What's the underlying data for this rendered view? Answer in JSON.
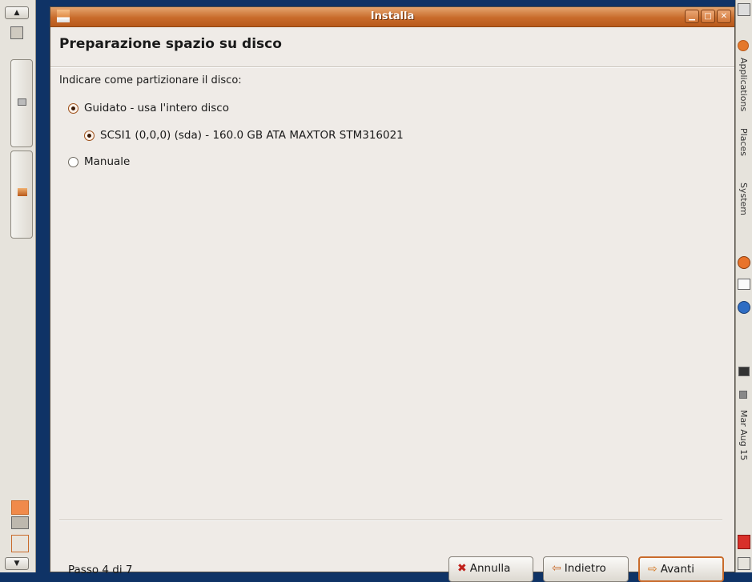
{
  "window": {
    "title": "Installa"
  },
  "page": {
    "title": "Preparazione spazio su disco",
    "instruction": "Indicare come partizionare il disco:"
  },
  "options": {
    "guided": {
      "label": "Guidato - usa l'intero disco",
      "selected": true
    },
    "disk": {
      "label": "SCSI1 (0,0,0) (sda) - 160.0 GB ATA MAXTOR STM316021",
      "selected": true
    },
    "manual": {
      "label": "Manuale",
      "selected": false
    }
  },
  "footer": {
    "step": "Passo 4 di 7",
    "cancel_label": "Annulla",
    "back_label": "Indietro",
    "forward_label": "Avanti"
  },
  "right_panel": {
    "menu_applications": "Applications",
    "menu_places": "Places",
    "menu_system": "System",
    "clock": "Mar Aug 15"
  },
  "colors": {
    "desktop": "#0f3366",
    "title_accent": "#c96b2b",
    "window_bg": "#efebe7"
  },
  "icons": {
    "cancel": "cancel-x-icon",
    "back": "arrow-left-icon",
    "forward": "arrow-right-icon",
    "installer": "installer-icon"
  }
}
